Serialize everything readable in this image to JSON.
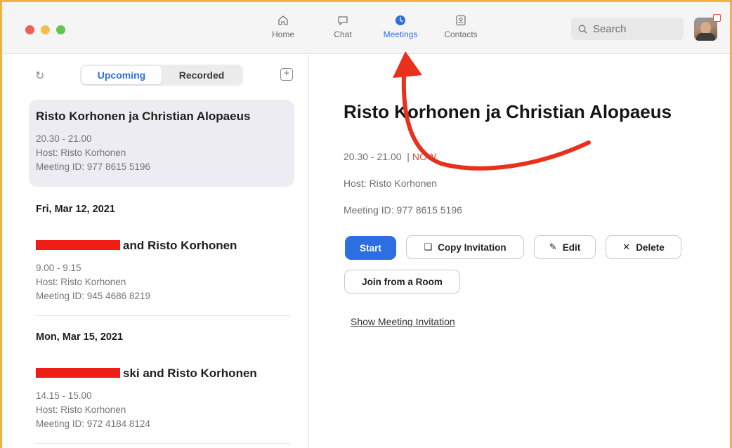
{
  "nav": {
    "home": "Home",
    "chat": "Chat",
    "meetings": "Meetings",
    "contacts": "Contacts"
  },
  "search": {
    "placeholder": "Search"
  },
  "tabs": {
    "upcoming": "Upcoming",
    "recorded": "Recorded"
  },
  "meetings": [
    {
      "title": "Risto Korhonen ja Christian Alopaeus",
      "time": "20.30 - 21.00",
      "host": "Host: Risto Korhonen",
      "meeting_id": "Meeting ID: 977 8615 5196"
    },
    {
      "date": "Fri, Mar 12, 2021",
      "title_suffix": "and Risto Korhonen",
      "time": "9.00 - 9.15",
      "host": "Host: Risto Korhonen",
      "meeting_id": "Meeting ID: 945 4686 8219"
    },
    {
      "date": "Mon, Mar 15, 2021",
      "title_suffix": "ski and Risto Korhonen",
      "time": "14.15 - 15.00",
      "host": "Host: Risto Korhonen",
      "meeting_id": "Meeting ID: 972 4184 8124"
    }
  ],
  "detail": {
    "title": "Risto Korhonen ja Christian Alopaeus",
    "time": "20.30 - 21.00",
    "separator": "|",
    "now": "NOW",
    "host": "Host: Risto Korhonen",
    "meeting_id": "Meeting ID: 977 8615 5196",
    "buttons": {
      "start": "Start",
      "copy": "Copy Invitation",
      "edit": "Edit",
      "delete": "Delete",
      "join_room": "Join from a Room"
    },
    "show_invitation": "Show Meeting Invitation"
  },
  "colors": {
    "accent": "#2d6fe0",
    "frame": "#f4b13d",
    "annotation_arrow": "#e8301c",
    "redaction": "#f01d17",
    "now": "#e24a3b"
  }
}
